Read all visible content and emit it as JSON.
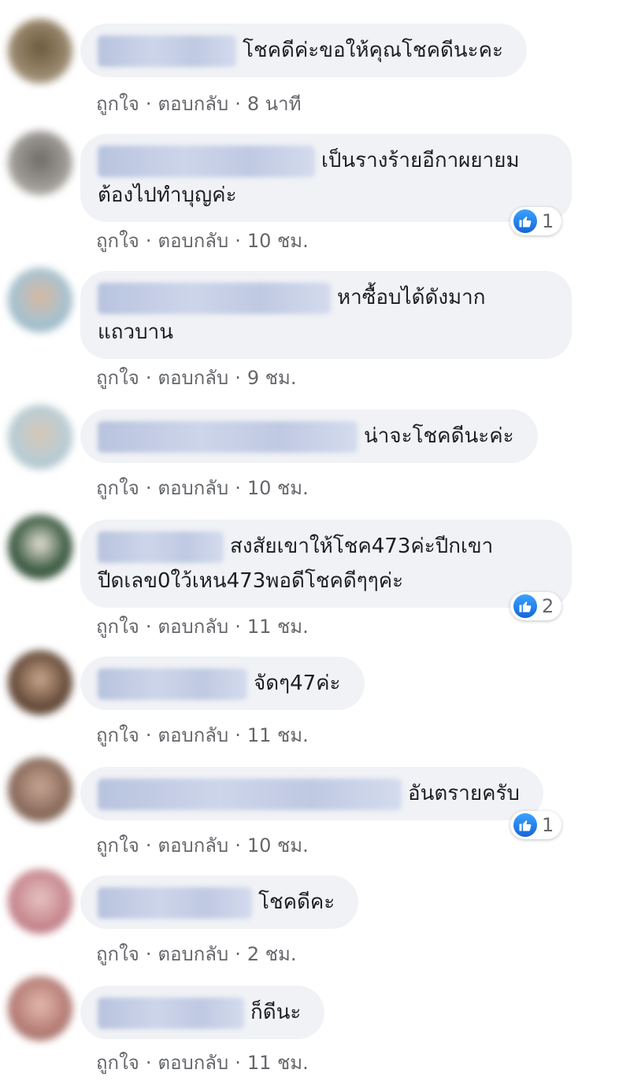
{
  "labels": {
    "like": "ถูกใจ",
    "reply": "ตอบกลับ",
    "separator": "·"
  },
  "colors": {
    "bubble_bg": "#f0f2f5",
    "meta_text": "#65676b",
    "like_blue": "#1877f2"
  },
  "comments": [
    {
      "text": "โชคดีค่ะขอให้คุณโชคดีนะคะ",
      "time": "8 นาที",
      "avatar_color": "#7a6a4e"
    },
    {
      "text_line1": "เป็นรางร้ายอีกาผยายม",
      "text_line2": "ต้องไปทำบุญค่ะ",
      "time": "10 ชม.",
      "reactions": "1",
      "avatar_color": "#8c8a86"
    },
    {
      "text_line1": "หาซื้อบได้ดังมาก",
      "text_line2": "แถวบาน",
      "time": "9 ชม.",
      "avatar_color": "#a8c2cf"
    },
    {
      "text": "น่าจะโชคดีนะค่ะ",
      "time": "10 ชม.",
      "avatar_color": "#b9cdd4"
    },
    {
      "text_line1": "สงสัยเขาให้โชค473ค่ะปีกเขา",
      "text_line2": "ปีดเลข0ใว้เหน473พอดีโชคดีๆๆค่ะ",
      "time": "11 ชม.",
      "reactions": "2",
      "avatar_color": "#3f5e45"
    },
    {
      "text": "จัดๆ47ค่ะ",
      "time": "11 ชม.",
      "avatar_color": "#6b4f3e"
    },
    {
      "text": "อันตรายครับ",
      "time": "10 ชม.",
      "reactions": "1",
      "avatar_color": "#8d6e5e"
    },
    {
      "text": "โชคดีคะ",
      "time": "2 ชม.",
      "avatar_color": "#c98a92"
    },
    {
      "text": "ก็ดีนะ",
      "time": "11 ชม.",
      "avatar_color": "#b77f78"
    }
  ]
}
